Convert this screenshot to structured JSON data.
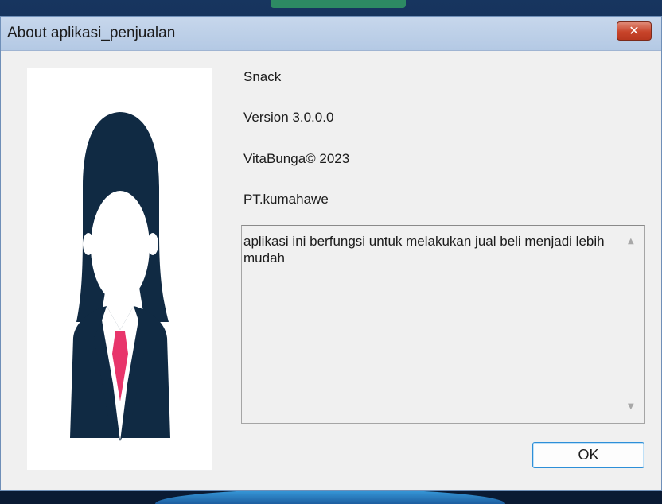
{
  "window": {
    "title": "About aplikasi_penjualan",
    "close_glyph": "✕"
  },
  "about": {
    "product_name": "Snack",
    "version": "Version 3.0.0.0",
    "copyright": "VitaBunga© 2023",
    "company": "PT.kumahawe",
    "description": "aplikasi ini berfungsi untuk melakukan jual beli menjadi lebih mudah"
  },
  "logo": {
    "icon": "woman-avatar-icon",
    "colors": {
      "figure": "#102a43",
      "tie": "#e8356b",
      "shirt": "#ffffff"
    }
  },
  "scrollbar": {
    "up_arrow": "▲",
    "down_arrow": "▼"
  },
  "buttons": {
    "ok_label": "OK"
  },
  "colors": {
    "titlebar": "#b9cce6",
    "close_button": "#c8442a",
    "dialog_bg": "#f0f0f0",
    "ok_border": "#2d8fd8"
  }
}
